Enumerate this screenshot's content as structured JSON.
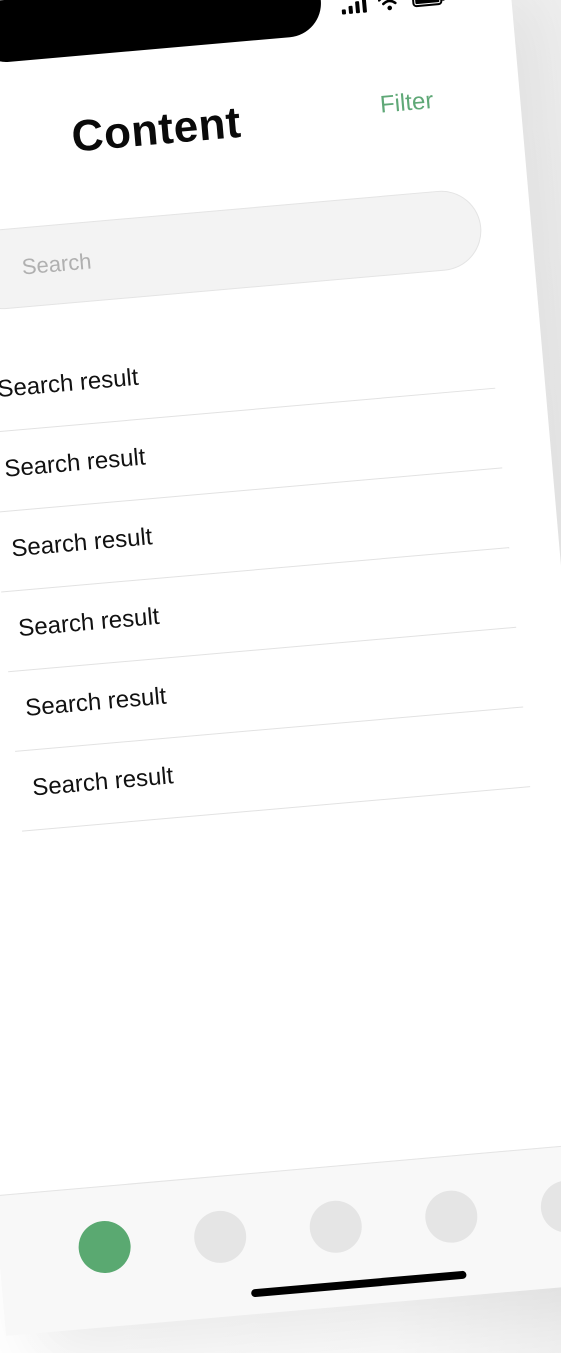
{
  "header": {
    "title": "Content",
    "filter_label": "Filter"
  },
  "search": {
    "placeholder": "Search"
  },
  "results": [
    "Search result",
    "Search result",
    "Search result",
    "Search result",
    "Search result",
    "Search result"
  ],
  "tabbar": {
    "tabs": [
      "tab-1",
      "tab-2",
      "tab-3",
      "tab-4",
      "tab-5"
    ],
    "active_index": 0
  },
  "colors": {
    "accent": "#5fa877",
    "active_tab": "#5aa971",
    "inactive_tab": "#e5e5e5"
  },
  "status_bar": {
    "icons": [
      "signal-icon",
      "wifi-icon",
      "battery-icon"
    ]
  }
}
